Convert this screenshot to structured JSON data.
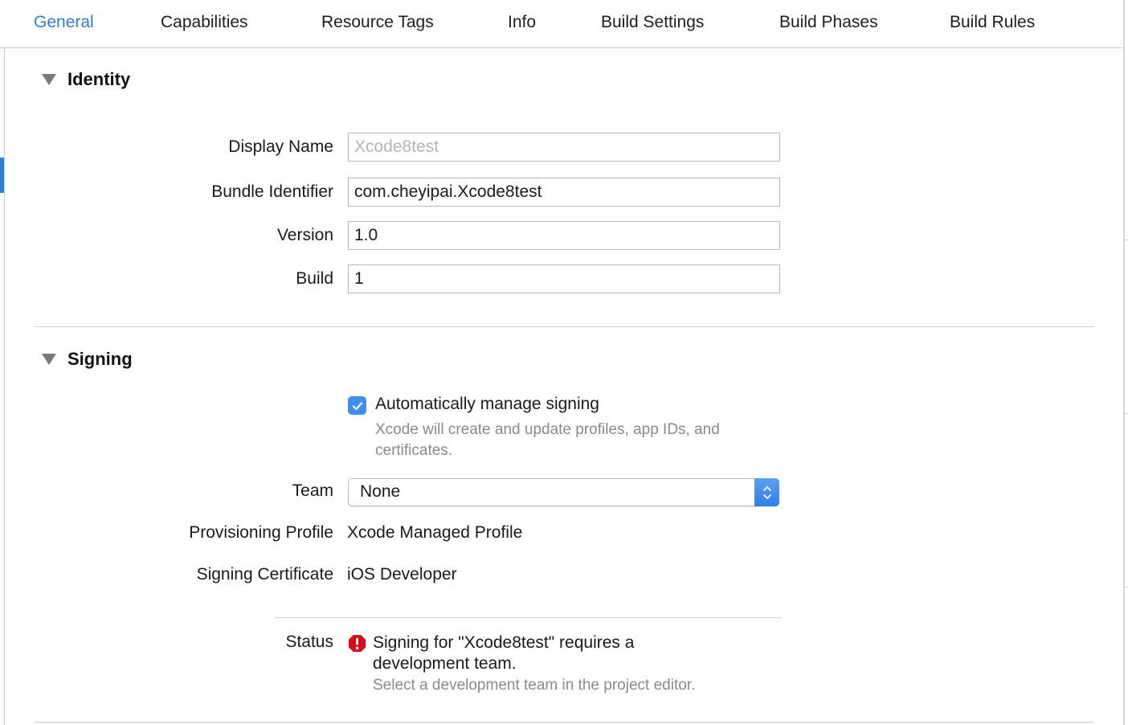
{
  "tabs": [
    {
      "label": "General",
      "active": true
    },
    {
      "label": "Capabilities",
      "active": false
    },
    {
      "label": "Resource Tags",
      "active": false
    },
    {
      "label": "Info",
      "active": false
    },
    {
      "label": "Build Settings",
      "active": false
    },
    {
      "label": "Build Phases",
      "active": false
    },
    {
      "label": "Build Rules",
      "active": false
    }
  ],
  "identity": {
    "title": "Identity",
    "display_name": {
      "label": "Display Name",
      "placeholder": "Xcode8test",
      "value": ""
    },
    "bundle_identifier": {
      "label": "Bundle Identifier",
      "value": "com.cheyipai.Xcode8test"
    },
    "version": {
      "label": "Version",
      "value": "1.0"
    },
    "build": {
      "label": "Build",
      "value": "1"
    }
  },
  "signing": {
    "title": "Signing",
    "auto_manage": {
      "label": "Automatically manage signing",
      "checked": true,
      "help": "Xcode will create and update profiles, app IDs, and certificates."
    },
    "team": {
      "label": "Team",
      "selected": "None"
    },
    "provisioning_profile": {
      "label": "Provisioning Profile",
      "value": "Xcode Managed Profile"
    },
    "signing_certificate": {
      "label": "Signing Certificate",
      "value": "iOS Developer"
    },
    "status": {
      "label": "Status",
      "message": "Signing for \"Xcode8test\" requires a development team.",
      "help": "Select a development team in the project editor."
    }
  },
  "colors": {
    "accent": "#2f7fd4",
    "checkbox": "#3d8ff0",
    "error": "#d0101a"
  },
  "icons": {
    "disclosure": "disclosure-triangle-down-icon",
    "checkbox": "checkmark-icon",
    "popup": "up-down-chevron-icon",
    "status": "error-exclamation-icon"
  }
}
